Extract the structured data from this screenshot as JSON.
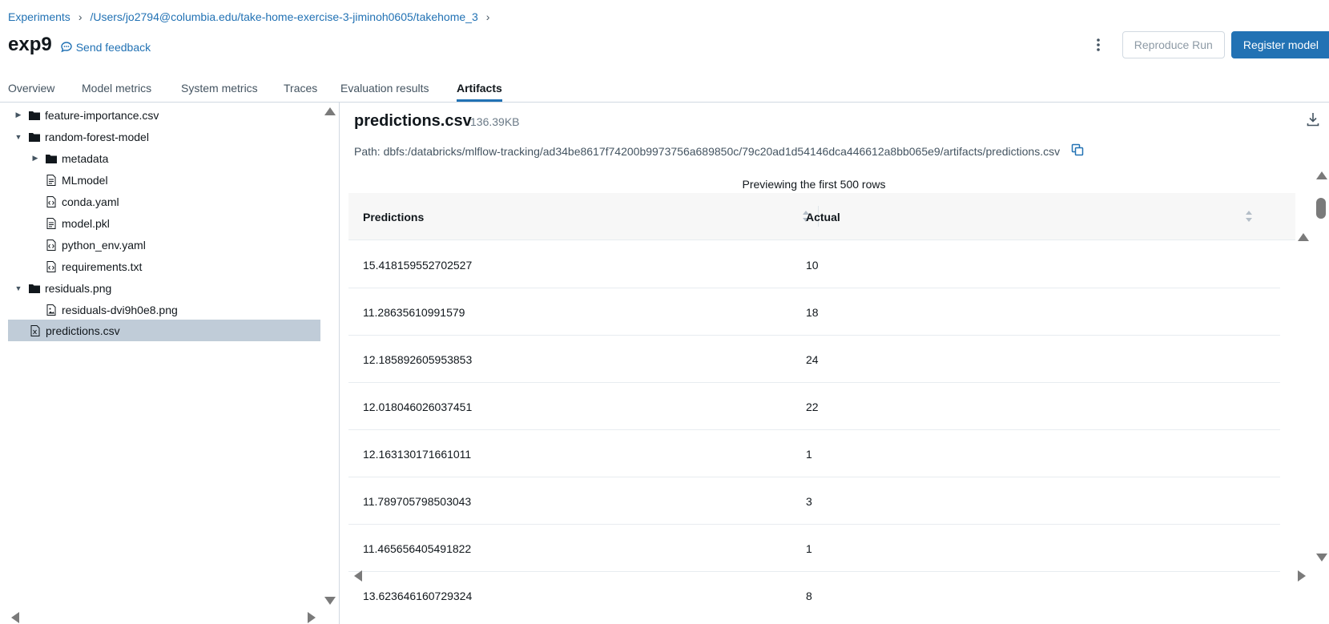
{
  "breadcrumb": {
    "root": "Experiments",
    "path": "/Users/jo2794@columbia.edu/take-home-exercise-3-jiminoh0605/takehome_3"
  },
  "header": {
    "title": "exp9",
    "feedback_label": "Send feedback",
    "reproduce_label": "Reproduce Run",
    "register_label": "Register model"
  },
  "tabs": [
    {
      "label": "Overview"
    },
    {
      "label": "Model metrics"
    },
    {
      "label": "System metrics"
    },
    {
      "label": "Traces"
    },
    {
      "label": "Evaluation results"
    },
    {
      "label": "Artifacts"
    }
  ],
  "tree": [
    {
      "label": "feature-importance.csv"
    },
    {
      "label": "random-forest-model"
    },
    {
      "label": "metadata"
    },
    {
      "label": "MLmodel"
    },
    {
      "label": "conda.yaml"
    },
    {
      "label": "model.pkl"
    },
    {
      "label": "python_env.yaml"
    },
    {
      "label": "requirements.txt"
    },
    {
      "label": "residuals.png"
    },
    {
      "label": "residuals-dvi9h0e8.png"
    },
    {
      "label": "predictions.csv"
    }
  ],
  "file": {
    "name": "predictions.csv",
    "size": "136.39KB",
    "path": "Path: dbfs:/databricks/mlflow-tracking/ad34be8617f74200b9973756a689850c/79c20ad1d54146dca446612a8bb065e9/artifacts/predictions.csv",
    "preview_note": "Previewing the first 500 rows"
  },
  "table": {
    "columns": [
      "Predictions",
      "Actual"
    ],
    "rows": [
      [
        "15.418159552702527",
        "10"
      ],
      [
        "11.28635610991579",
        "18"
      ],
      [
        "12.185892605953853",
        "24"
      ],
      [
        "12.018046026037451",
        "22"
      ],
      [
        "12.163130171661011",
        "1"
      ],
      [
        "11.789705798503043",
        "3"
      ],
      [
        "11.465656405491822",
        "1"
      ],
      [
        "13.623646160729324",
        "8"
      ]
    ]
  },
  "colors": {
    "accent": "#2272b4",
    "selected_row": "#c0ccd8"
  }
}
